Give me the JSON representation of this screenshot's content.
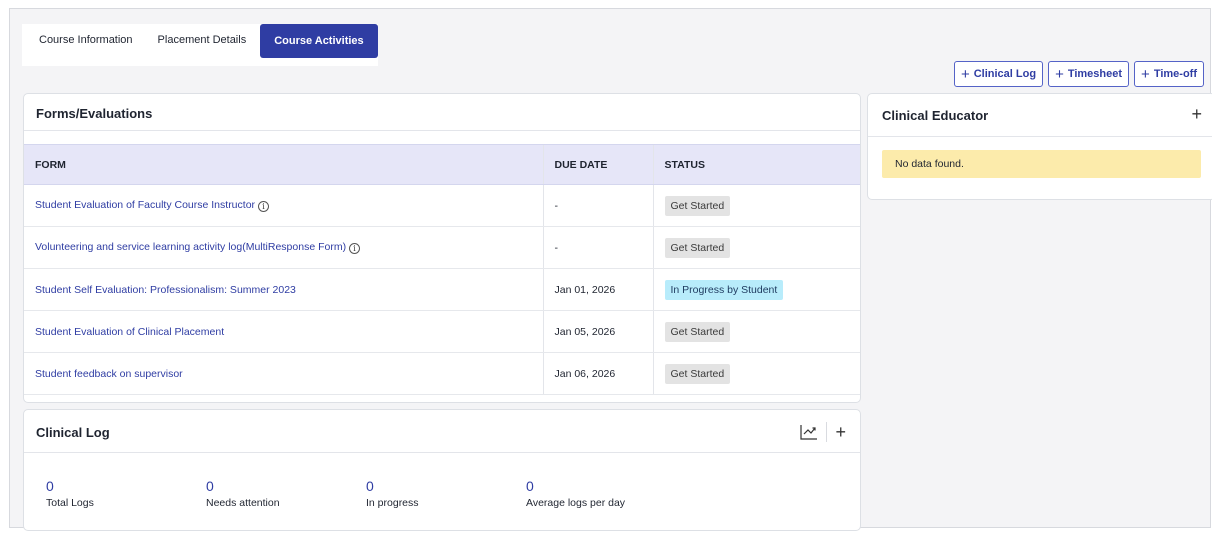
{
  "tabs": [
    {
      "label": "Course Information",
      "active": false
    },
    {
      "label": "Placement Details",
      "active": false
    },
    {
      "label": "Course Activities",
      "active": true
    }
  ],
  "actions": [
    {
      "label": "Clinical Log",
      "icon": "plus-icon"
    },
    {
      "label": "Timesheet",
      "icon": "plus-icon"
    },
    {
      "label": "Time-off",
      "icon": "plus-icon"
    }
  ],
  "forms": {
    "title": "Forms/Evaluations",
    "columns": [
      "FORM",
      "DUE DATE",
      "STATUS"
    ],
    "rows": [
      {
        "form": "Student Evaluation of Faculty Course Instructor",
        "info": true,
        "due": "-",
        "status": "Get Started",
        "status_style": "gray"
      },
      {
        "form": "Volunteering and service learning activity log(MultiResponse Form)",
        "info": true,
        "due": "-",
        "status": "Get Started",
        "status_style": "gray"
      },
      {
        "form": "Student Self Evaluation: Professionalism: Summer 2023",
        "info": false,
        "due": "Jan 01, 2026",
        "status": "In Progress by Student",
        "status_style": "blue"
      },
      {
        "form": "Student Evaluation of Clinical Placement",
        "info": false,
        "due": "Jan 05, 2026",
        "status": "Get Started",
        "status_style": "gray"
      },
      {
        "form": "Student feedback on supervisor",
        "info": false,
        "due": "Jan 06, 2026",
        "status": "Get Started",
        "status_style": "gray"
      }
    ]
  },
  "clinical_log": {
    "title": "Clinical Log",
    "stats": [
      {
        "value": "0",
        "label": "Total Logs"
      },
      {
        "value": "0",
        "label": "Needs attention"
      },
      {
        "value": "0",
        "label": "In progress"
      },
      {
        "value": "0",
        "label": "Average logs per day"
      }
    ]
  },
  "educator": {
    "title": "Clinical Educator",
    "empty_text": "No data found."
  },
  "colors": {
    "primary": "#2f3da3",
    "header_bg": "#e6e6f8",
    "badge_gray": "#e3e3e3",
    "badge_blue": "#b8ecfb",
    "notice_yellow": "#fcebab"
  }
}
